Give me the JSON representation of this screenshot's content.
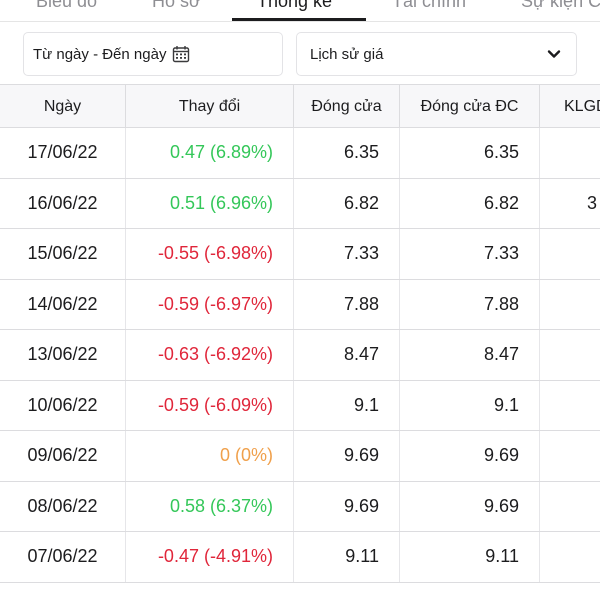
{
  "tabs": [
    {
      "label": "Biểu đồ",
      "active": false
    },
    {
      "label": "Hồ sơ",
      "active": false
    },
    {
      "label": "Thống kê",
      "active": true
    },
    {
      "label": "Tài chính",
      "active": false
    },
    {
      "label": "Sự kiện C",
      "active": false
    }
  ],
  "filters": {
    "date_range_label": "Từ ngày - Đến ngày",
    "date_icon": "calendar-icon",
    "history_select_value": "Lịch sử giá",
    "select_icon": "chevron-down-icon"
  },
  "table": {
    "headers": [
      "Ngày",
      "Thay đổi",
      "Đóng cửa",
      "Đóng cửa ĐC",
      "KLGD"
    ],
    "rows": [
      {
        "date": "17/06/22",
        "change": "0.47 (6.89%)",
        "trend": "up",
        "close": "6.35",
        "adj_close": "6.35",
        "volume": ""
      },
      {
        "date": "16/06/22",
        "change": "0.51 (6.96%)",
        "trend": "up",
        "close": "6.82",
        "adj_close": "6.82",
        "volume": "3"
      },
      {
        "date": "15/06/22",
        "change": "-0.55 (-6.98%)",
        "trend": "down",
        "close": "7.33",
        "adj_close": "7.33",
        "volume": ""
      },
      {
        "date": "14/06/22",
        "change": "-0.59 (-6.97%)",
        "trend": "down",
        "close": "7.88",
        "adj_close": "7.88",
        "volume": ""
      },
      {
        "date": "13/06/22",
        "change": "-0.63 (-6.92%)",
        "trend": "down",
        "close": "8.47",
        "adj_close": "8.47",
        "volume": ""
      },
      {
        "date": "10/06/22",
        "change": "-0.59 (-6.09%)",
        "trend": "down",
        "close": "9.1",
        "adj_close": "9.1",
        "volume": ""
      },
      {
        "date": "09/06/22",
        "change": "0 (0%)",
        "trend": "flat",
        "close": "9.69",
        "adj_close": "9.69",
        "volume": ""
      },
      {
        "date": "08/06/22",
        "change": "0.58 (6.37%)",
        "trend": "up",
        "close": "9.69",
        "adj_close": "9.69",
        "volume": ""
      },
      {
        "date": "07/06/22",
        "change": "-0.47 (-4.91%)",
        "trend": "down",
        "close": "9.11",
        "adj_close": "9.11",
        "volume": ""
      }
    ]
  },
  "colors": {
    "up": "#34c759",
    "down": "#e0263a",
    "flat": "#f0a04b",
    "header_bg": "#f7f7f9",
    "border": "#dcdcdf"
  }
}
